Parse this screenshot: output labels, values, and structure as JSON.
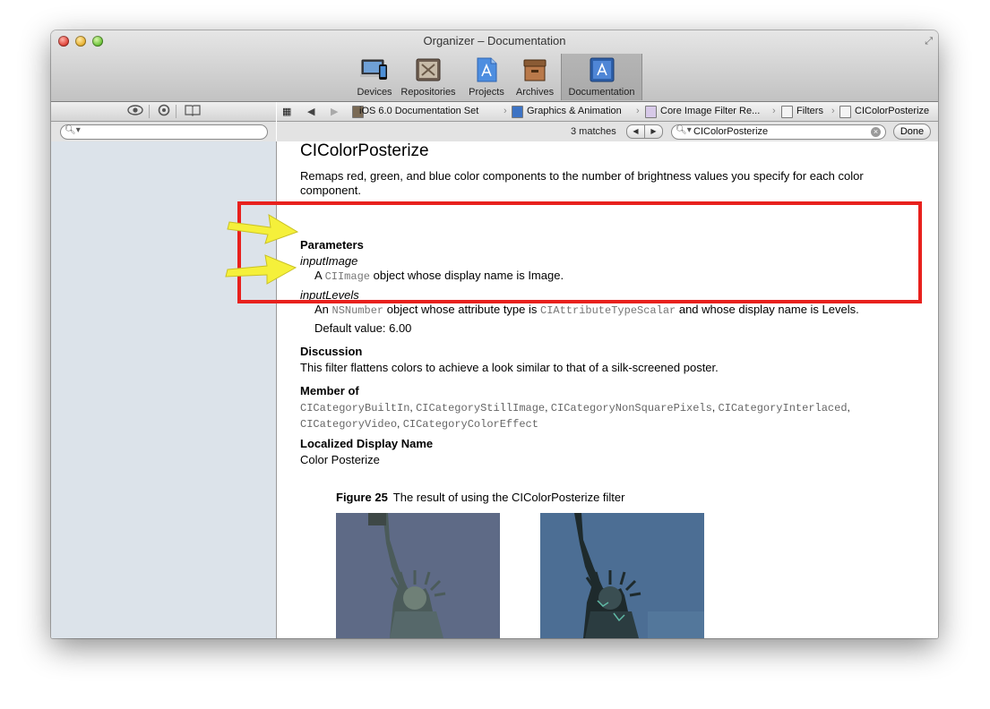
{
  "window": {
    "title": "Organizer – Documentation"
  },
  "toolbar": {
    "items": [
      {
        "label": "Devices",
        "icon": "devices-icon"
      },
      {
        "label": "Repositories",
        "icon": "repositories-icon"
      },
      {
        "label": "Projects",
        "icon": "projects-icon"
      },
      {
        "label": "Archives",
        "icon": "archives-icon"
      },
      {
        "label": "Documentation",
        "icon": "documentation-icon",
        "active": true
      }
    ]
  },
  "sidebar": {
    "segments": [
      "eye-icon",
      "search-icon",
      "book-icon"
    ],
    "search_placeholder": ""
  },
  "jumpbar": {
    "items": [
      {
        "label": "iOS 6.0 Documentation Set"
      },
      {
        "label": "Graphics & Animation"
      },
      {
        "label": "Core Image Filter Re..."
      },
      {
        "label": "Filters"
      },
      {
        "label": "CIColorPosterize"
      }
    ]
  },
  "findbar": {
    "matches": "3 matches",
    "query": "CIColorPosterize",
    "done_label": "Done"
  },
  "doc": {
    "title": "CIColorPosterize",
    "abstract": "Remaps red, green, and blue color components to the number of brightness values you specify for each color component.",
    "parameters_heading": "Parameters",
    "param1": {
      "name": "inputImage",
      "pre": "A ",
      "code": "CIImage",
      "post": " object whose display name is Image."
    },
    "param2": {
      "name": "inputLevels",
      "pre": "An ",
      "code": "NSNumber",
      "mid": " object whose attribute type is ",
      "code2": "CIAttributeTypeScalar",
      "post": " and whose display name is Levels.",
      "default": "Default value: 6.00"
    },
    "discussion_heading": "Discussion",
    "discussion": "This filter flattens colors to achieve a look similar to that of a silk-screened poster.",
    "member_heading": "Member of",
    "members": [
      "CICategoryBuiltIn",
      "CICategoryStillImage",
      "CICategoryNonSquarePixels",
      "CICategoryInterlaced",
      "CICategoryVideo",
      "CICategoryColorEffect"
    ],
    "localized_heading": "Localized Display Name",
    "localized": "Color Posterize",
    "figure_label": "Figure 25",
    "figure_caption": "The result of using the CIColorPosterize filter"
  },
  "colors": {
    "highlight": "#e8211d",
    "arrow": "#f5f03a",
    "sidebar_bg": "#dce3ea"
  }
}
